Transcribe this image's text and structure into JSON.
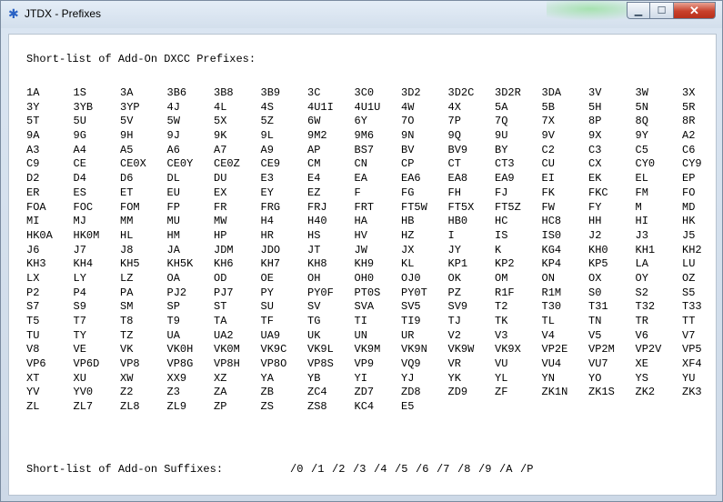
{
  "window": {
    "title": "JTDX - Prefixes"
  },
  "prefix_heading": "Short-list of Add-On DXCC Prefixes:",
  "prefixes": [
    "1A",
    "1S",
    "3A",
    "3B6",
    "3B8",
    "3B9",
    "3C",
    "3C0",
    "3D2",
    "3D2C",
    "3D2R",
    "3DA",
    "3V",
    "3W",
    "3X",
    "3Y",
    "3YB",
    "3YP",
    "4J",
    "4L",
    "4S",
    "4U1I",
    "4U1U",
    "4W",
    "4X",
    "5A",
    "5B",
    "5H",
    "5N",
    "5R",
    "5T",
    "5U",
    "5V",
    "5W",
    "5X",
    "5Z",
    "6W",
    "6Y",
    "7O",
    "7P",
    "7Q",
    "7X",
    "8P",
    "8Q",
    "8R",
    "9A",
    "9G",
    "9H",
    "9J",
    "9K",
    "9L",
    "9M2",
    "9M6",
    "9N",
    "9Q",
    "9U",
    "9V",
    "9X",
    "9Y",
    "A2",
    "A3",
    "A4",
    "A5",
    "A6",
    "A7",
    "A9",
    "AP",
    "BS7",
    "BV",
    "BV9",
    "BY",
    "C2",
    "C3",
    "C5",
    "C6",
    "C9",
    "CE",
    "CE0X",
    "CE0Y",
    "CE0Z",
    "CE9",
    "CM",
    "CN",
    "CP",
    "CT",
    "CT3",
    "CU",
    "CX",
    "CY0",
    "CY9",
    "D2",
    "D4",
    "D6",
    "DL",
    "DU",
    "E3",
    "E4",
    "EA",
    "EA6",
    "EA8",
    "EA9",
    "EI",
    "EK",
    "EL",
    "EP",
    "ER",
    "ES",
    "ET",
    "EU",
    "EX",
    "EY",
    "EZ",
    "F",
    "FG",
    "FH",
    "FJ",
    "FK",
    "FKC",
    "FM",
    "FO",
    "FOA",
    "FOC",
    "FOM",
    "FP",
    "FR",
    "FRG",
    "FRJ",
    "FRT",
    "FT5W",
    "FT5X",
    "FT5Z",
    "FW",
    "FY",
    "M",
    "MD",
    "MI",
    "MJ",
    "MM",
    "MU",
    "MW",
    "H4",
    "H40",
    "HA",
    "HB",
    "HB0",
    "HC",
    "HC8",
    "HH",
    "HI",
    "HK",
    "HK0A",
    "HK0M",
    "HL",
    "HM",
    "HP",
    "HR",
    "HS",
    "HV",
    "HZ",
    "I",
    "IS",
    "IS0",
    "J2",
    "J3",
    "J5",
    "J6",
    "J7",
    "J8",
    "JA",
    "JDM",
    "JDO",
    "JT",
    "JW",
    "JX",
    "JY",
    "K",
    "KG4",
    "KH0",
    "KH1",
    "KH2",
    "KH3",
    "KH4",
    "KH5",
    "KH5K",
    "KH6",
    "KH7",
    "KH8",
    "KH9",
    "KL",
    "KP1",
    "KP2",
    "KP4",
    "KP5",
    "LA",
    "LU",
    "LX",
    "LY",
    "LZ",
    "OA",
    "OD",
    "OE",
    "OH",
    "OH0",
    "OJ0",
    "OK",
    "OM",
    "ON",
    "OX",
    "OY",
    "OZ",
    "P2",
    "P4",
    "PA",
    "PJ2",
    "PJ7",
    "PY",
    "PY0F",
    "PT0S",
    "PY0T",
    "PZ",
    "R1F",
    "R1M",
    "S0",
    "S2",
    "S5",
    "S7",
    "S9",
    "SM",
    "SP",
    "ST",
    "SU",
    "SV",
    "SVA",
    "SV5",
    "SV9",
    "T2",
    "T30",
    "T31",
    "T32",
    "T33",
    "T5",
    "T7",
    "T8",
    "T9",
    "TA",
    "TF",
    "TG",
    "TI",
    "TI9",
    "TJ",
    "TK",
    "TL",
    "TN",
    "TR",
    "TT",
    "TU",
    "TY",
    "TZ",
    "UA",
    "UA2",
    "UA9",
    "UK",
    "UN",
    "UR",
    "V2",
    "V3",
    "V4",
    "V5",
    "V6",
    "V7",
    "V8",
    "VE",
    "VK",
    "VK0H",
    "VK0M",
    "VK9C",
    "VK9L",
    "VK9M",
    "VK9N",
    "VK9W",
    "VK9X",
    "VP2E",
    "VP2M",
    "VP2V",
    "VP5",
    "VP6",
    "VP6D",
    "VP8",
    "VP8G",
    "VP8H",
    "VP8O",
    "VP8S",
    "VP9",
    "VQ9",
    "VR",
    "VU",
    "VU4",
    "VU7",
    "XE",
    "XF4",
    "XT",
    "XU",
    "XW",
    "XX9",
    "XZ",
    "YA",
    "YB",
    "YI",
    "YJ",
    "YK",
    "YL",
    "YN",
    "YO",
    "YS",
    "YU",
    "YV",
    "YV0",
    "Z2",
    "Z3",
    "ZA",
    "ZB",
    "ZC4",
    "ZD7",
    "ZD8",
    "ZD9",
    "ZF",
    "ZK1N",
    "ZK1S",
    "ZK2",
    "ZK3",
    "ZL",
    "ZL7",
    "ZL8",
    "ZL9",
    "ZP",
    "ZS",
    "ZS8",
    "KC4",
    "E5"
  ],
  "suffix_heading": "Short-list of Add-on Suffixes:",
  "suffixes": [
    "/0",
    "/1",
    "/2",
    "/3",
    "/4",
    "/5",
    "/6",
    "/7",
    "/8",
    "/9",
    "/A",
    "/P"
  ]
}
